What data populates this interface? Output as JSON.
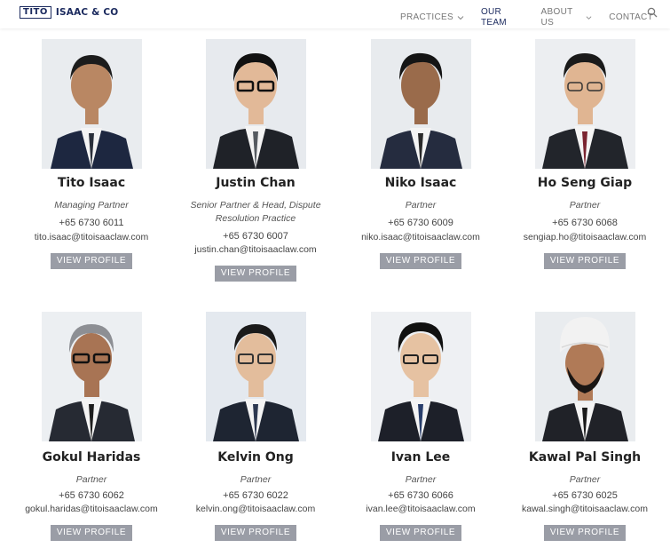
{
  "header": {
    "logo_box": "TITO",
    "logo_rest": "ISAAC & CO",
    "nav": [
      "PRACTICES",
      "OUR TEAM",
      "ABOUT US",
      "CONTACT"
    ]
  },
  "team": [
    {
      "name": "Tito Isaac",
      "role": "Managing Partner",
      "phone": "+65 6730 6011",
      "email": "tito.isaac@titoisaaclaw.com",
      "button": "VIEW PROFILE"
    },
    {
      "name": "Justin Chan",
      "role": "Senior Partner & Head, Dispute Resolution Practice",
      "phone": "+65 6730 6007",
      "email": "justin.chan@titoisaaclaw.com",
      "button": "VIEW PROFILE"
    },
    {
      "name": "Niko Isaac",
      "role": "Partner",
      "phone": "+65 6730 6009",
      "email": "niko.isaac@titoisaaclaw.com",
      "button": "VIEW PROFILE"
    },
    {
      "name": "Ho Seng Giap",
      "role": "Partner",
      "phone": "+65 6730 6068",
      "email": "sengiap.ho@titoisaaclaw.com",
      "button": "VIEW PROFILE"
    },
    {
      "name": "Gokul Haridas",
      "role": "Partner",
      "phone": "+65 6730 6062",
      "email": "gokul.haridas@titoisaaclaw.com",
      "button": "VIEW PROFILE"
    },
    {
      "name": "Kelvin Ong",
      "role": "Partner",
      "phone": "+65 6730 6022",
      "email": "kelvin.ong@titoisaaclaw.com",
      "button": "VIEW PROFILE"
    },
    {
      "name": "Ivan Lee",
      "role": "Partner",
      "phone": "+65 6730 6066",
      "email": "ivan.lee@titoisaaclaw.com",
      "button": "VIEW PROFILE"
    },
    {
      "name": "Kawal Pal Singh",
      "role": "Partner",
      "phone": "+65 6730 6025",
      "email": "kawal.singh@titoisaaclaw.com",
      "button": "VIEW PROFILE"
    }
  ],
  "colors": {
    "brand": "#1b2a5e",
    "button": "#9a9da6"
  }
}
